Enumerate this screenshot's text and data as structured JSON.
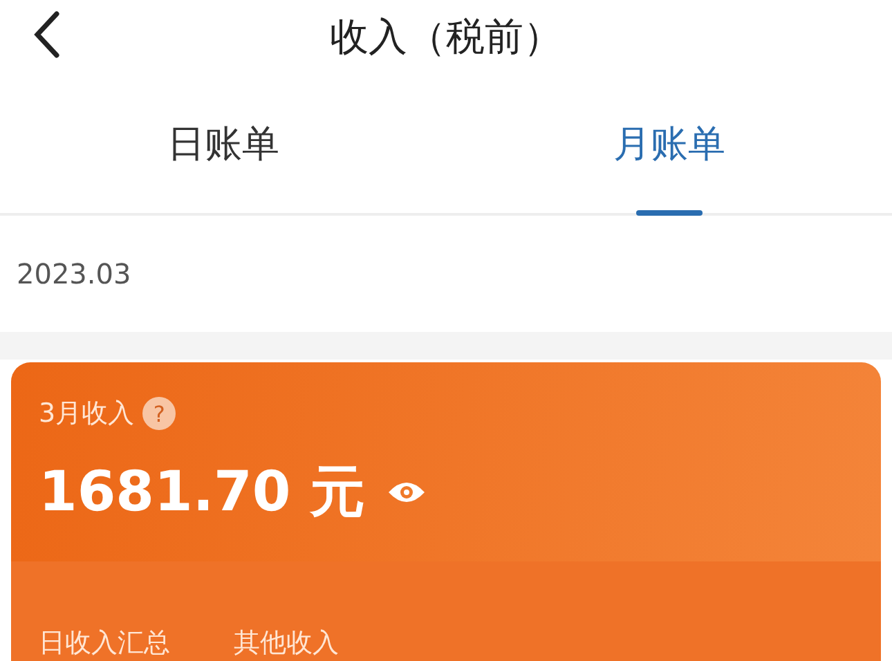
{
  "header": {
    "title": "收入（税前）"
  },
  "tabs": [
    {
      "label": "日账单",
      "selected": false
    },
    {
      "label": "月账单",
      "selected": true
    }
  ],
  "period": {
    "label": "2023.03"
  },
  "income_card": {
    "label": "3月收入",
    "help": "?",
    "amount": "1681.70 元",
    "links": [
      {
        "label": "日收入汇总"
      },
      {
        "label": "其他收入"
      }
    ]
  }
}
